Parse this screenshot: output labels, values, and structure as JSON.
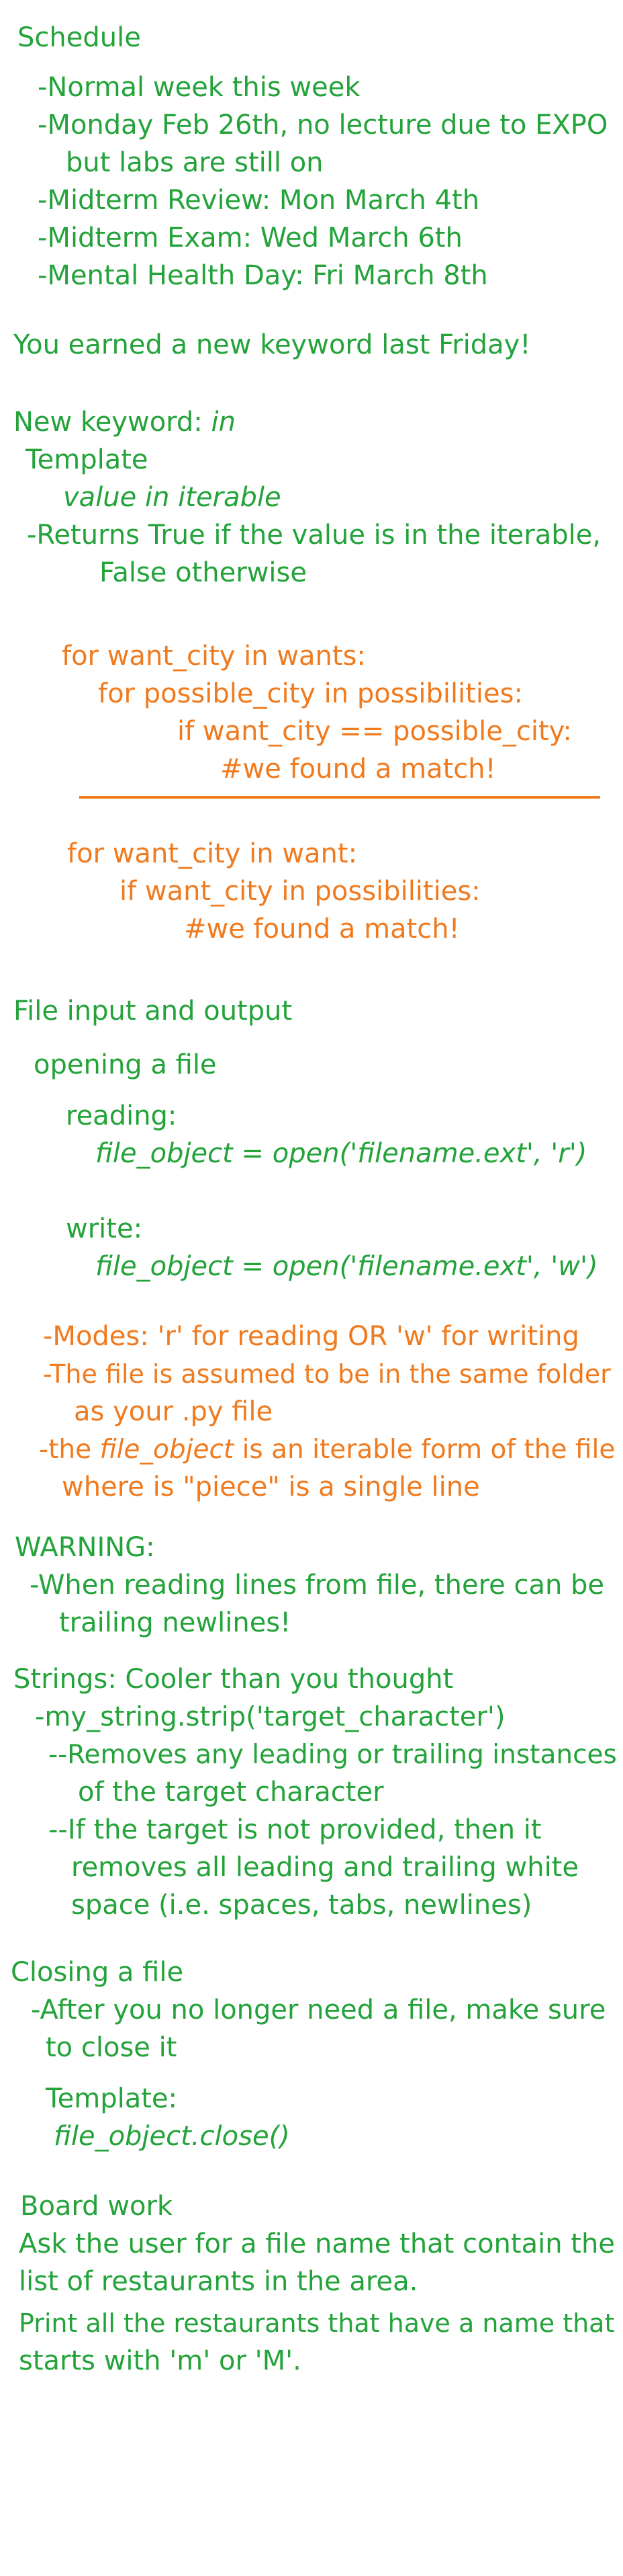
{
  "schedule": {
    "heading": "Schedule",
    "items": [
      "-Normal week this week",
      "-Monday Feb 26th, no lecture due to EXPO",
      "but labs are still on",
      "-Midterm Review: Mon March 4th",
      "-Midterm Exam: Wed March 6th",
      "-Mental Health Day: Fri March 8th"
    ]
  },
  "keyword_earned": "You earned a new keyword last Friday!",
  "keyword": {
    "heading_prefix": "New keyword: ",
    "heading_keyword": "in",
    "template_label": "Template",
    "template_expr": "value in iterable",
    "returns_1": "-Returns True if the value is in the iterable,",
    "returns_2": "False otherwise",
    "code_nested": [
      "for want_city in wants:",
      "for possible_city in possibilities:",
      "if want_city == possible_city:",
      "#we found a match!"
    ],
    "code_in": [
      "for want_city in want:",
      "if want_city in possibilities:",
      "#we found a match!"
    ]
  },
  "file_io": {
    "heading": "File input and output",
    "opening": "opening a file",
    "reading_label": "reading:",
    "reading_code": "file_object = open('filename.ext', 'r')",
    "write_label": "write:",
    "write_code": "file_object = open('filename.ext', 'w')",
    "modes": "-Modes: 'r' for reading OR 'w' for writing",
    "folder_1": "-The file is assumed to be in the same folder",
    "folder_2": "as your .py file",
    "iter_prefix": "-the ",
    "iter_code": "file_object",
    "iter_suffix": " is an iterable form of the file",
    "iter_2": "where is \"piece\" is a single line"
  },
  "warning": {
    "heading": "WARNING:",
    "line1": "-When reading lines from file, there can be",
    "line2": "trailing newlines!"
  },
  "strings": {
    "heading": "Strings: Cooler than you thought",
    "method": "-my_string.strip('target_character')",
    "desc": [
      "--Removes any leading or trailing instances",
      "of the target character",
      "--If the target is not provided, then it",
      "removes all leading and trailing white",
      "space (i.e. spaces, tabs, newlines)"
    ]
  },
  "closing": {
    "heading": "Closing a file",
    "line1": "-After you no longer need a file, make sure",
    "line2": "to close it",
    "template_label": "Template:",
    "template_code": "file_object.close()"
  },
  "board": {
    "heading": "Board work",
    "lines": [
      "Ask the user for a file name that contain the",
      "list of restaurants in the area.",
      "Print all the restaurants that have a name that",
      "starts with 'm' or 'M'."
    ]
  },
  "colors": {
    "green": "#23a33a",
    "orange": "#f07a1e"
  }
}
